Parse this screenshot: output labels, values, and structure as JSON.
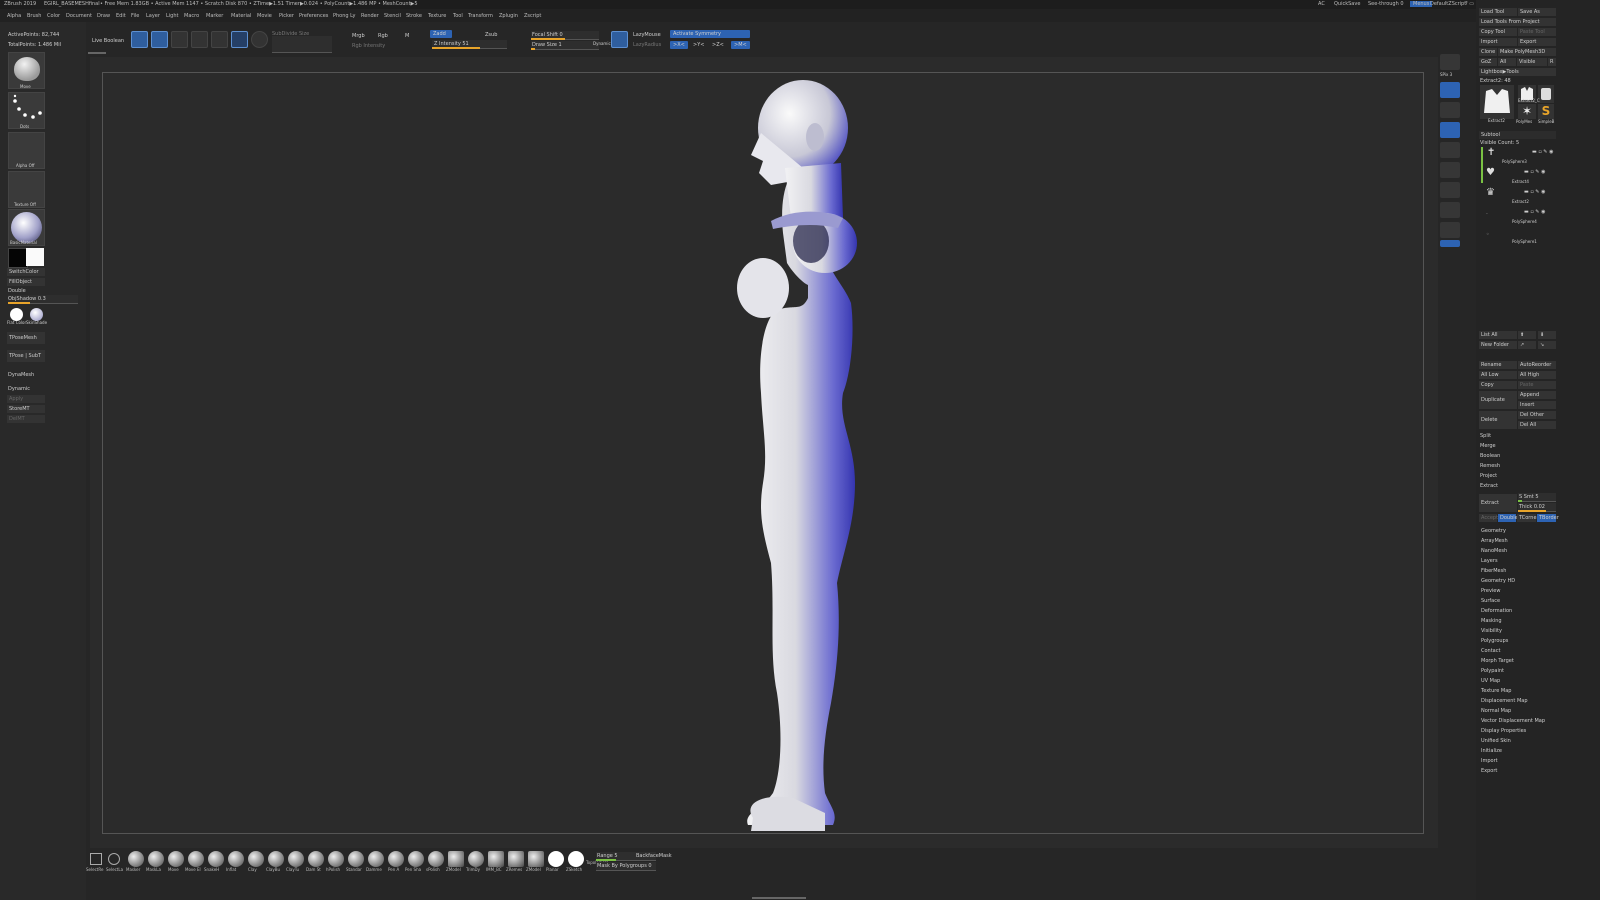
{
  "titlebar": {
    "app": "ZBrush 2019",
    "file": "EGIRL_BASEMESHfinal",
    "stats": "• Free Mem 1.83GB • Active Mem 1147 • Scratch Disk 870 • ZTime▶1.51 Timer▶0.024 • PolyCount▶1.486 MP • MeshCount▶5",
    "ac": "AC",
    "quicksave": "QuickSave",
    "seethrough": "See-through   0",
    "menus": "Menus",
    "script": "DefaultZScript"
  },
  "menubar": [
    "Alpha",
    "Brush",
    "Color",
    "Document",
    "Draw",
    "Edit",
    "File",
    "Layer",
    "Light",
    "Macro",
    "Marker",
    "Material",
    "Movie",
    "Picker",
    "Preferences",
    "Phong Ly",
    "Render",
    "Stencil",
    "Stroke",
    "Texture",
    "Tool",
    "Transform",
    "Zplugin",
    "Zscript"
  ],
  "shelf": {
    "live_boolean": "Live Boolean",
    "tool_buttons": [
      "Edit",
      "Draw",
      "Move",
      "Scale",
      "Rotate"
    ],
    "subdiv": "SubDivide Size",
    "curvature": "Mrgb",
    "rgb": "Rgb",
    "m": "M",
    "zadd": "Zadd",
    "zsub": "Zsub",
    "zintensity": "Z Intensity 51",
    "rgb_intensity": "Rgb Intensity",
    "focal_shift": "Focal Shift 0",
    "draw_size": "Draw Size 1",
    "dynamic": "Dynamic",
    "lazymouse": "LazyMouse",
    "lazyradius": "LazyRadius",
    "activate_symmetry": "Activate Symmetry",
    "sym_x": ">X<",
    "sym_y": ">Y<",
    "sym_z": ">Z<",
    "sym_m": ">M<"
  },
  "lefttray": {
    "active_points": "ActivePoints: 82,744",
    "total_points": "TotalPoints: 1.486 Mil",
    "brush_label": "Move",
    "stroke_label": "Dots",
    "alpha_label": "Alpha Off",
    "texture_label": "Texture Off",
    "material_label": "BasicMaterial",
    "switchcolor": "SwitchColor",
    "fillobject": "FillObject",
    "double": "Double",
    "objshadow": "ObjShadow 0.3",
    "flatcolor": "Flat Color",
    "skinshade": "SkinShade",
    "tposemesh": "TPoseMesh",
    "tpose_subt": "TPose | SubT",
    "dynamesh": "DynaMesh",
    "dynamic": "Dynamic",
    "apply": "Apply",
    "storemt": "StoreMT",
    "delmt": "DelMT"
  },
  "rightpanel": {
    "load_tool": "Load Tool",
    "save_as": "Save As",
    "load_tools_project": "Load Tools From Project",
    "copy_tool": "Copy Tool",
    "paste_tool": "Paste Tool",
    "import": "Import",
    "export": "Export",
    "clone": "Clone",
    "make_polymesh": "Make PolyMesh3D",
    "goz": "GoZ",
    "all": "All",
    "visible": "Visible",
    "r": "R",
    "lightbox_tools": "Lightbox▶Tools",
    "extract_value": "Extract2: 48",
    "thumb1": "Extract2",
    "thumb2": "Extract2_C",
    "thumb3": "PolyMes",
    "thumb4": "SimpleB",
    "subtool": "Subtool",
    "visible_count": "Visible Count: 5",
    "subtools": [
      "PolySphere3",
      "Extract4",
      "Extract2",
      "PolySphere4",
      "PolySphere1"
    ],
    "list_all": "List All",
    "new_folder": "New Folder",
    "rename": "Rename",
    "autoreorder": "AutoReorder",
    "all_low": "All Low",
    "all_high": "All High",
    "copy": "Copy",
    "paste": "Paste",
    "duplicate": "Duplicate",
    "append": "Append",
    "insert": "Insert",
    "delete": "Delete",
    "del_other": "Del Other",
    "del_all": "Del All",
    "split": "Split",
    "merge": "Merge",
    "boolean": "Boolean",
    "remesh": "Remesh",
    "project": "Project",
    "extract": "Extract",
    "extract_btn": "Extract",
    "s_smt": "S Smt 5",
    "thick": "Thick 0.02",
    "accept": "Accept",
    "double": "Double",
    "tcorne": "TCorne",
    "tborder": "TBorder",
    "menus": [
      "Geometry",
      "ArrayMesh",
      "NanoMesh",
      "Layers",
      "FiberMesh",
      "Geometry HD",
      "Preview",
      "Surface",
      "Deformation",
      "Masking",
      "Visibility",
      "Polygroups",
      "Contact",
      "Morph Target",
      "Polypaint",
      "UV Map",
      "Texture Map",
      "Displacement Map",
      "Normal Map",
      "Vector Displacement Map",
      "Display Properties",
      "Unified Skin",
      "Initialize",
      "Import",
      "Export"
    ]
  },
  "rightshelf": [
    "BPR",
    "SPix 3",
    "Scroll",
    "Zoom",
    "Actual",
    "AAHalf",
    "Persp",
    "Floor",
    "Local",
    "Frame",
    "Move",
    "Zoom3D",
    "Rotate",
    "Line Fill",
    "PolyF",
    "Transp",
    "Ghost",
    "Solo",
    "Xpose"
  ],
  "bottomshelf": {
    "brushes": [
      "SelectRe",
      "SelectLa",
      "Masker",
      "MaskLa",
      "Move",
      "Move El",
      "SnakeH",
      "Inflat",
      "Clay",
      "ClayBu",
      "ClayTu",
      "Dam St",
      "hPolish",
      "Standar",
      "Damme",
      "Pen A",
      "Pen Sha",
      "sPolish",
      "ZModel",
      "TrimDy",
      "IMM_BC",
      "ZRemes",
      "ZModel",
      "Planar",
      "ZSketch",
      "Topological"
    ],
    "range": "Range 5",
    "backface": "BackfaceMask",
    "mask_polygroups": "Mask By Polygroups 0"
  }
}
